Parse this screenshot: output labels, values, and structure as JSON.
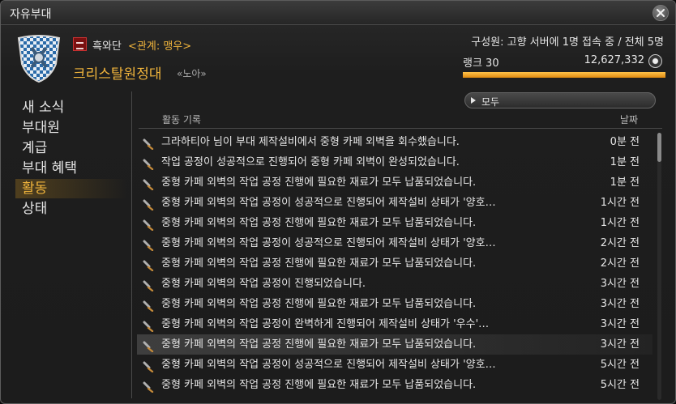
{
  "window": {
    "title": "자유부대"
  },
  "header": {
    "grand_company": "흑와단",
    "relation": "<관계: 맹우>",
    "fc_name": "크리스탈원정대",
    "fc_tag": "«노아»",
    "members": "구성원: 고향 서버에 1명 접속 중 / 전체 5명",
    "rank": "랭크 30",
    "points": "12,627,332",
    "rank_progress_percent": 100
  },
  "sidebar": {
    "items": [
      {
        "label": "새 소식"
      },
      {
        "label": "부대원"
      },
      {
        "label": "계급"
      },
      {
        "label": "부대 혜택"
      },
      {
        "label": "활동"
      },
      {
        "label": "상태"
      }
    ],
    "active_index": 4
  },
  "content": {
    "filter_label": "모두",
    "column_activity": "활동 기록",
    "column_date": "날짜",
    "rows": [
      {
        "text": "그라하티아 님이 부대 제작설비에서 중형 카페 외벽을 회수했습니다.",
        "time": "0분 전"
      },
      {
        "text": "작업 공정이 성공적으로 진행되어 중형 카페 외벽이 완성되었습니다.",
        "time": "1분 전"
      },
      {
        "text": "중형 카페 외벽의 작업 공정 진행에 필요한 재료가 모두 납품되었습니다.",
        "time": "1분 전"
      },
      {
        "text": "중형 카페 외벽의 작업 공정이 성공적으로 진행되어 제작설비 상태가 '양호…",
        "time": "1시간 전"
      },
      {
        "text": "중형 카페 외벽의 작업 공정 진행에 필요한 재료가 모두 납품되었습니다.",
        "time": "1시간 전"
      },
      {
        "text": "중형 카페 외벽의 작업 공정이 성공적으로 진행되어 제작설비 상태가 '양호…",
        "time": "2시간 전"
      },
      {
        "text": "중형 카페 외벽의 작업 공정 진행에 필요한 재료가 모두 납품되었습니다.",
        "time": "2시간 전"
      },
      {
        "text": "중형 카페 외벽의 작업 공정이 진행되었습니다.",
        "time": "3시간 전"
      },
      {
        "text": "중형 카페 외벽의 작업 공정 진행에 필요한 재료가 모두 납품되었습니다.",
        "time": "3시간 전"
      },
      {
        "text": "중형 카페 외벽의 작업 공정이 완벽하게 진행되어 제작설비 상태가 '우수'…",
        "time": "3시간 전"
      },
      {
        "text": "중형 카페 외벽의 작업 공정 진행에 필요한 재료가 모두 납품되었습니다.",
        "time": "3시간 전"
      },
      {
        "text": "중형 카페 외벽의 작업 공정이 성공적으로 진행되어 제작설비 상태가 '양호…",
        "time": "5시간 전"
      },
      {
        "text": "중형 카페 외벽의 작업 공정 진행에 필요한 재료가 모두 납품되었습니다.",
        "time": "5시간 전"
      }
    ],
    "highlight_index": 10
  },
  "colors": {
    "accent": "#f0b43c",
    "text": "#e6e6e6",
    "bar": "#f0a020"
  }
}
